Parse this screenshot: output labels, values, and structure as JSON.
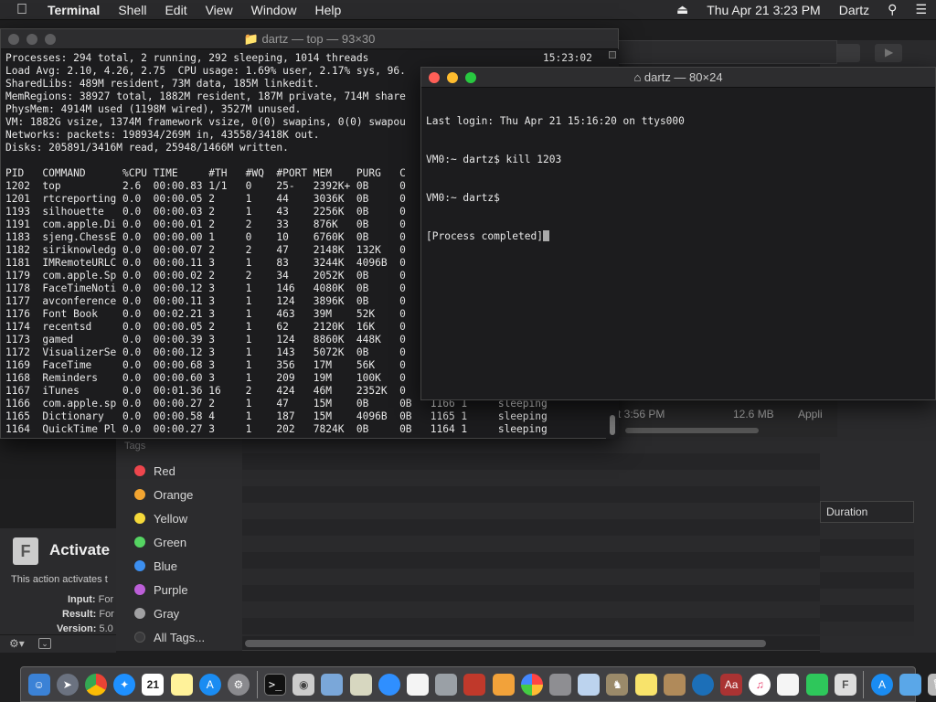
{
  "menubar": {
    "apple": "",
    "app": "Terminal",
    "items": [
      "Shell",
      "Edit",
      "View",
      "Window",
      "Help"
    ],
    "clock": "Thu Apr 21  3:23 PM",
    "user": "Dartz"
  },
  "top_window": {
    "title": "dartz — top — 93×30",
    "clock": "15:23:02",
    "lines": [
      "Processes: 294 total, 2 running, 292 sleeping, 1014 threads",
      "Load Avg: 2.10, 4.26, 2.75  CPU usage: 1.69% user, 2.17% sys, 96.",
      "SharedLibs: 489M resident, 73M data, 185M linkedit.",
      "MemRegions: 38927 total, 1882M resident, 187M private, 714M share",
      "PhysMem: 4914M used (1198M wired), 3527M unused.",
      "VM: 1882G vsize, 1374M framework vsize, 0(0) swapins, 0(0) swapou",
      "Networks: packets: 198934/269M in, 43558/3418K out.",
      "Disks: 205891/3416M read, 25948/1466M written.",
      "",
      "PID   COMMAND      %CPU TIME     #TH   #WQ  #PORT MEM    PURG   C",
      "1202  top          2.6  00:00.83 1/1   0    25-   2392K+ 0B     0",
      "1201  rtcreporting 0.0  00:00.05 2     1    44    3036K  0B     0",
      "1193  silhouette   0.0  00:00.03 2     1    43    2256K  0B     0",
      "1191  com.apple.Di 0.0  00:00.01 2     2    33    876K   0B     0",
      "1183  sjeng.ChessE 0.0  00:00.00 1     0    10    6760K  0B     0",
      "1182  siriknowledg 0.0  00:00.07 2     2    47    2148K  132K   0",
      "1181  IMRemoteURLC 0.0  00:00.11 3     1    83    3244K  4096B  0",
      "1179  com.apple.Sp 0.0  00:00.02 2     2    34    2052K  0B     0",
      "1178  FaceTimeNoti 0.0  00:00.12 3     1    146   4080K  0B     0",
      "1177  avconference 0.0  00:00.11 3     1    124   3896K  0B     0",
      "1176  Font Book    0.0  00:02.21 3     1    463   39M    52K    0",
      "1174  recentsd     0.0  00:00.05 2     1    62    2120K  16K    0",
      "1173  gamed        0.0  00:00.39 3     1    124   8860K  448K   0",
      "1172  VisualizerSe 0.0  00:00.12 3     1    143   5072K  0B     0",
      "1169  FaceTime     0.0  00:00.68 3     1    356   17M    56K    0",
      "1168  Reminders    0.0  00:00.60 3     1    209   19M    100K   0",
      "1167  iTunes       0.0  00:01.36 16    2    424   46M    2352K  0",
      "1166  com.apple.sp 0.0  00:00.27 2     1    47    15M    0B     0B   1166 1     sleeping",
      "1165  Dictionary   0.0  00:00.58 4     1    187   15M    4096B  0B   1165 1     sleeping",
      "1164  QuickTime Pl 0.0  00:00.27 3     1    202   7824K  0B     0B   1164 1     sleeping"
    ]
  },
  "kill_window": {
    "title": "dartz — 80×24",
    "lines": [
      "Last login: Thu Apr 21 15:16:20 on ttys000",
      "VM0:~ dartz$ kill 1203",
      "VM0:~ dartz$ ",
      "[Process completed]"
    ]
  },
  "tags": {
    "header": "Tags",
    "items": [
      {
        "label": "Red",
        "color": "#f0474e"
      },
      {
        "label": "Orange",
        "color": "#f3a531"
      },
      {
        "label": "Yellow",
        "color": "#f5d93a"
      },
      {
        "label": "Green",
        "color": "#55d462"
      },
      {
        "label": "Blue",
        "color": "#3c8ff0"
      },
      {
        "label": "Purple",
        "color": "#bc5fd8"
      },
      {
        "label": "Gray",
        "color": "#a1a1a3"
      },
      {
        "label": "All Tags...",
        "color": "#3a3a3c"
      }
    ]
  },
  "automator_info": {
    "title": "Activate",
    "description": "This action activates t",
    "input_label": "Input:",
    "input_value": "For",
    "result_label": "Result:",
    "result_value": "For",
    "version_label": "Version:",
    "version_value": "5.0"
  },
  "mid_list": {
    "time": "t 3:56 PM",
    "size": "12.6 MB",
    "kind": "Appli"
  },
  "duration_header": "Duration",
  "dock": {
    "items": [
      "finder",
      "launchpad",
      "chrome",
      "safari",
      "calendar",
      "notes",
      "app-store",
      "system-preferences",
      "terminal",
      "disk-utility",
      "preview",
      "script-editor",
      "feedback",
      "textedit",
      "automator",
      "photo-booth",
      "dictionary",
      "photos",
      "stickies",
      "mail",
      "chess",
      "notes2",
      "scripts",
      "quicktime",
      "dictionary2",
      "itunes",
      "reminders",
      "facetime",
      "font-book",
      "app-store2",
      "folder",
      "trash"
    ],
    "calendar_day": "21"
  }
}
